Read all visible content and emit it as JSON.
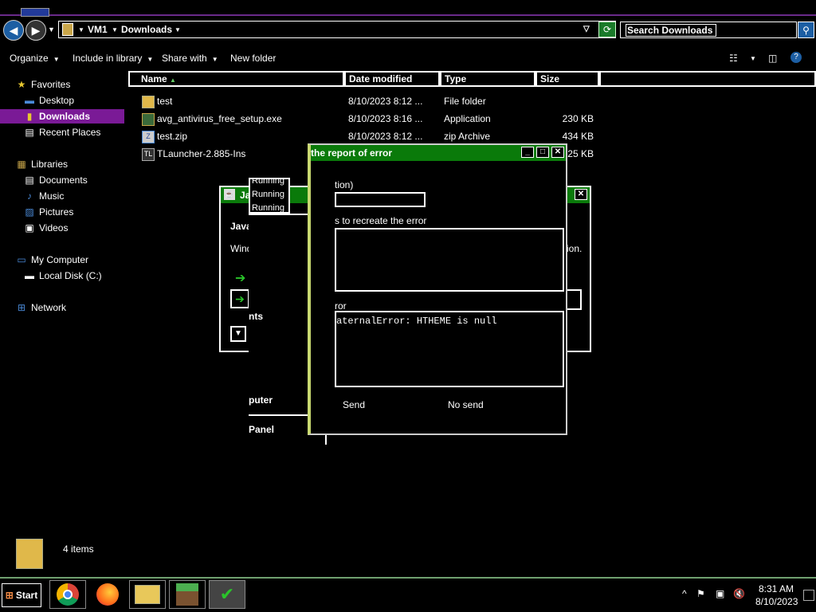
{
  "address": {
    "crumbs": [
      "VM1",
      "Downloads"
    ],
    "search_placeholder": "Search Downloads"
  },
  "toolbar": {
    "organize": "Organize",
    "include": "Include in library",
    "share": "Share with",
    "newfolder": "New folder"
  },
  "sidebar": {
    "favorites": "Favorites",
    "desktop": "Desktop",
    "downloads": "Downloads",
    "recent": "Recent Places",
    "libraries": "Libraries",
    "documents": "Documents",
    "music": "Music",
    "pictures": "Pictures",
    "videos": "Videos",
    "mycomputer": "My Computer",
    "localdisk": "Local Disk (C:)",
    "network": "Network"
  },
  "columns": {
    "name": "Name",
    "date": "Date modified",
    "type": "Type",
    "size": "Size"
  },
  "files": [
    {
      "name": "test",
      "date": "8/10/2023 8:12 ...",
      "type": "File folder",
      "size": ""
    },
    {
      "name": "avg_antivirus_free_setup.exe",
      "date": "8/10/2023 8:16 ...",
      "type": "Application",
      "size": "230 KB"
    },
    {
      "name": "test.zip",
      "date": "8/10/2023 8:12 ...",
      "type": "zip Archive",
      "size": "434 KB"
    },
    {
      "name": "TLauncher-2.885-Ins",
      "date": "",
      "type": "",
      "size": "25 KB"
    }
  ],
  "java_dialog": {
    "title": "Ja",
    "heading": "Java",
    "line": "Wind",
    "right_text": "ion.",
    "running1": "Running",
    "running2": "Running",
    "running3": "Running",
    "ents": "nts",
    "puter": "puter",
    "panel": "Panel"
  },
  "error_dialog": {
    "title": "the report of error",
    "field1_label": "tion)",
    "field2_label": "s to recreate the error",
    "field3_label": "ror",
    "error_text": "aternalError: HTHEME is null",
    "send": "Send",
    "nosend": "No send"
  },
  "status": {
    "items": "4 items"
  },
  "clock": {
    "time": "8:31 AM",
    "date": "8/10/2023"
  },
  "taskbar": {
    "start": "Start"
  },
  "colors": {
    "selection": "#7a1a96",
    "titlebar": "#0a7a0a",
    "accent": "#1c5ea3"
  }
}
